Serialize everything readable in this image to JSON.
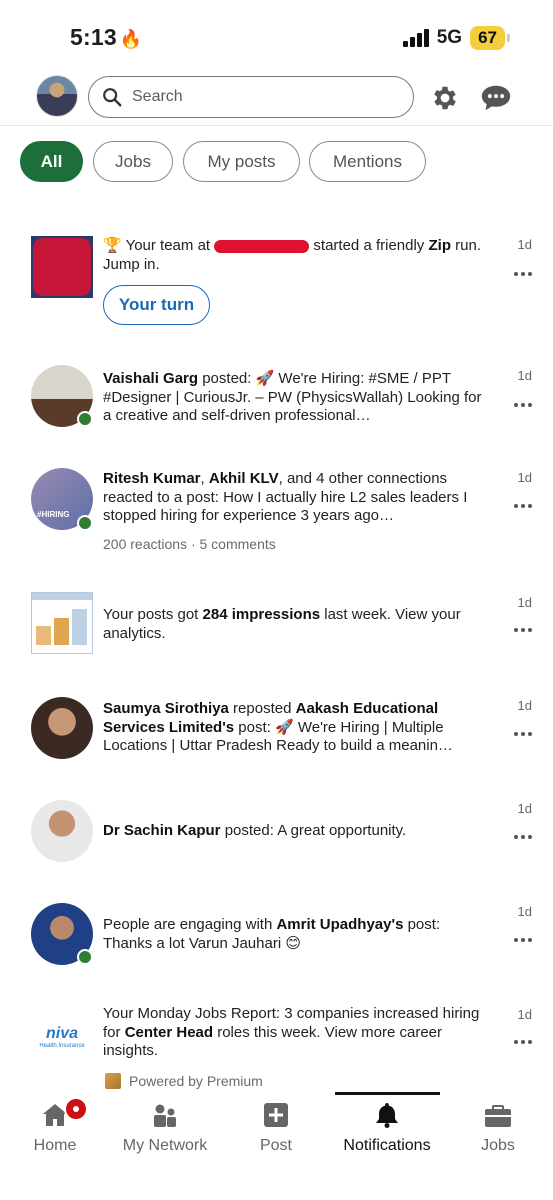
{
  "status_bar": {
    "time": "5:13",
    "network": "5G",
    "battery": "67"
  },
  "header": {
    "search_placeholder": "Search"
  },
  "filters": [
    {
      "label": "All",
      "active": true
    },
    {
      "label": "Jobs",
      "active": false
    },
    {
      "label": "My posts",
      "active": false
    },
    {
      "label": "Mentions",
      "active": false
    }
  ],
  "notifications": [
    {
      "time": "1d",
      "parts": [
        "🏆 Your team at ",
        "",
        " started a friendly ",
        "Zip",
        " run. Jump in."
      ],
      "action": "Your turn"
    },
    {
      "time": "1d",
      "name": "Vaishali Garg",
      "rest": " posted: 🚀 We're Hiring: #SME / PPT #Designer | CuriousJr. – PW (PhysicsWallah) Looking for a creative and self-driven professional…"
    },
    {
      "time": "1d",
      "name1": "Ritesh Kumar",
      "sep": ", ",
      "name2": "Akhil KLV",
      "rest": ", and 4 other connections reacted to a post: How I actually hire L2 sales leaders I stopped hiring for experience 3 years ago…",
      "meta": "200 reactions · 5 comments",
      "badge": "#HIRING"
    },
    {
      "time": "1d",
      "pre": "Your posts got ",
      "bold": "284 impressions",
      "rest": " last week. View your analytics."
    },
    {
      "time": "1d",
      "name1": "Saumya Sirothiya",
      "mid": " reposted ",
      "name2": "Aakash Educational Services Limited's",
      "rest": " post: 🚀 We're Hiring | Multiple Locations | Uttar Pradesh Ready to build a meanin…"
    },
    {
      "time": "1d",
      "name": "Dr Sachin Kapur",
      "rest": " posted: A great opportunity."
    },
    {
      "time": "1d",
      "pre": "People are engaging with ",
      "bold": "Amrit Upadhyay's",
      "rest": " post: Thanks a lot Varun Jauhari 😊"
    },
    {
      "time": "1d",
      "pre": "Your Monday Jobs Report: 3 companies increased hiring for ",
      "bold": "Center Head",
      "rest": " roles this week. View more career insights.",
      "logo": "niva",
      "logo_sub": "Health Insurance"
    }
  ],
  "powered_by": "Powered by Premium",
  "bottom_nav": [
    {
      "label": "Home",
      "icon": "home-icon"
    },
    {
      "label": "My Network",
      "icon": "network-icon"
    },
    {
      "label": "Post",
      "icon": "post-icon"
    },
    {
      "label": "Notifications",
      "icon": "bell-icon",
      "active": true
    },
    {
      "label": "Jobs",
      "icon": "briefcase-icon"
    }
  ],
  "colors": {
    "accent_green": "#1e6e3b",
    "link_blue": "#1a68b8",
    "badge_red": "#cc1016"
  }
}
